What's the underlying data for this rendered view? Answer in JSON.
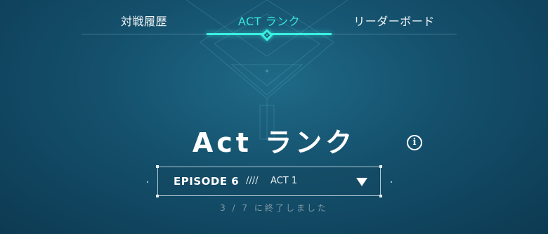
{
  "tabs": {
    "items": [
      {
        "label": "対戦履歴"
      },
      {
        "label": "ACT ランク"
      },
      {
        "label": "リーダーボード"
      }
    ],
    "active": "ACT ランク"
  },
  "header": {
    "title": "Act ランク",
    "info_label": "i"
  },
  "selector": {
    "episode": "EPISODE 6",
    "separator": "////",
    "act": "ACT 1"
  },
  "status": {
    "ended_text": "3 / 7 に終了しました"
  },
  "colors": {
    "accent": "#3af0e0",
    "background": "#14506c"
  }
}
